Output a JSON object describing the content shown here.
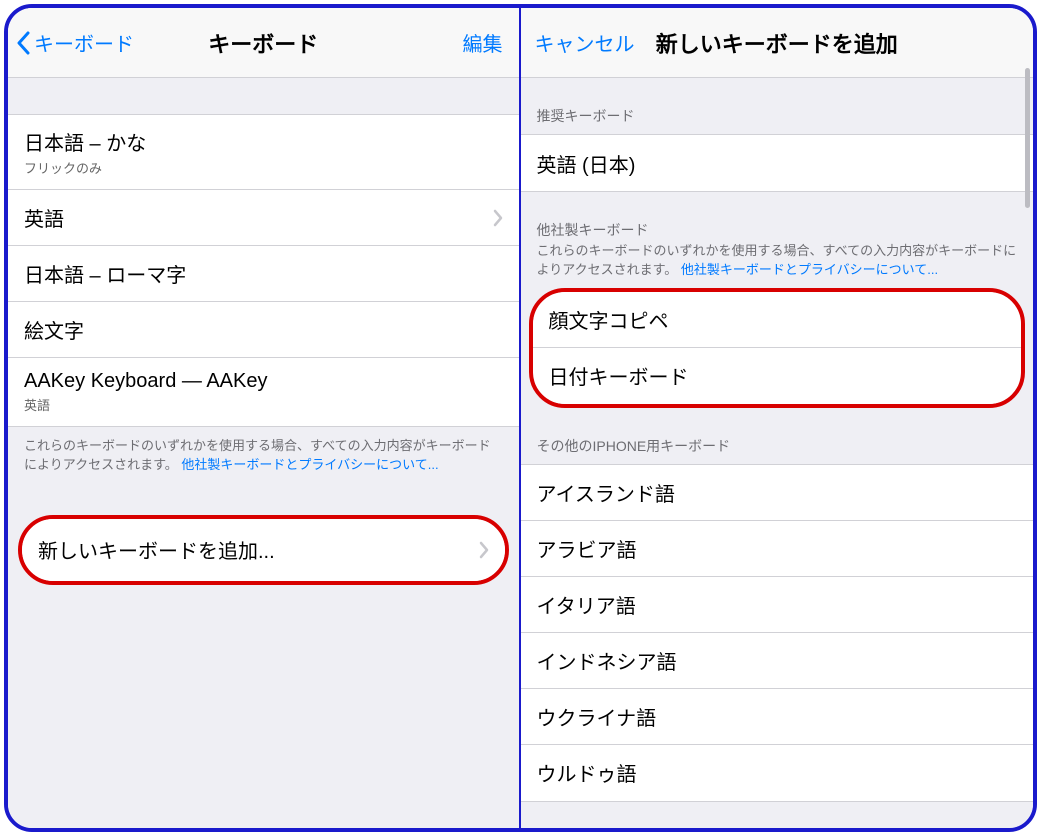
{
  "left": {
    "back_label": "キーボード",
    "title": "キーボード",
    "edit_label": "編集",
    "keyboards": [
      {
        "label": "日本語 – かな",
        "sub": "フリックのみ",
        "disclosure": false
      },
      {
        "label": "英語",
        "sub": null,
        "disclosure": true
      },
      {
        "label": "日本語 – ローマ字",
        "sub": null,
        "disclosure": false
      },
      {
        "label": "絵文字",
        "sub": null,
        "disclosure": false
      },
      {
        "label": "AAKey Keyboard — AAKey",
        "sub": "英語",
        "disclosure": false
      }
    ],
    "third_party_note": "これらのキーボードのいずれかを使用する場合、すべての入力内容がキーボードによりアクセスされます。",
    "third_party_link": "他社製キーボードとプライバシーについて...",
    "add_label": "新しいキーボードを追加..."
  },
  "right": {
    "cancel_label": "キャンセル",
    "title": "新しいキーボードを追加",
    "recommended_header": "推奨キーボード",
    "recommended": [
      {
        "label": "英語 (日本)"
      }
    ],
    "third_party_header": "他社製キーボード",
    "third_party_note": "これらのキーボードのいずれかを使用する場合、すべての入力内容がキーボードによりアクセスされます。",
    "third_party_link": "他社製キーボードとプライバシーについて...",
    "third_party": [
      {
        "label": "顔文字コピペ"
      },
      {
        "label": "日付キーボード"
      }
    ],
    "other_header": "その他のIPHONE用キーボード",
    "other": [
      {
        "label": "アイスランド語"
      },
      {
        "label": "アラビア語"
      },
      {
        "label": "イタリア語"
      },
      {
        "label": "インドネシア語"
      },
      {
        "label": "ウクライナ語"
      },
      {
        "label": "ウルドゥ語"
      }
    ]
  }
}
